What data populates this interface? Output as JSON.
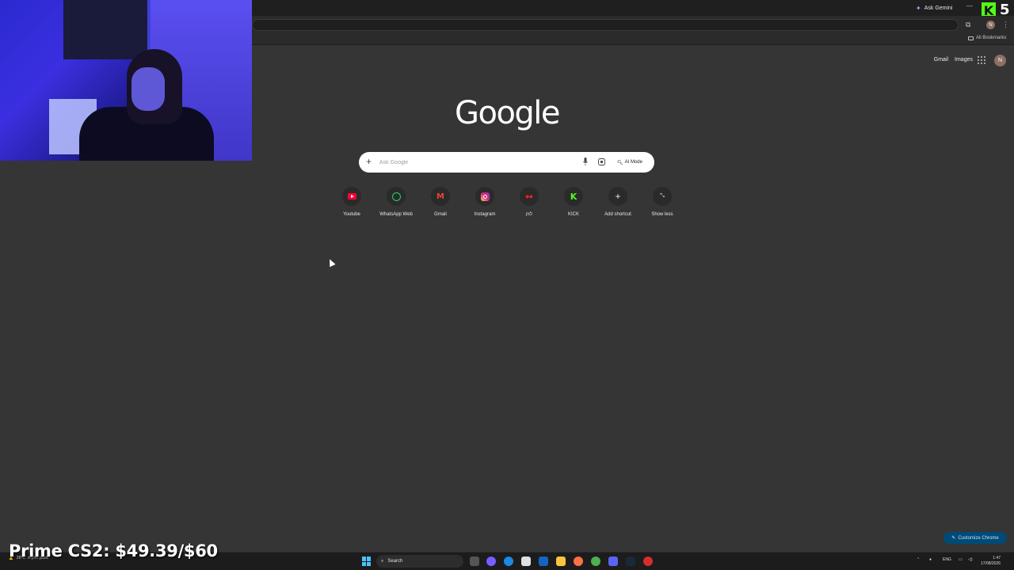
{
  "browser": {
    "ask_gemini": "Ask Gemini",
    "all_bookmarks": "All Bookmarks",
    "profile_initial": "N"
  },
  "stream_overlay": {
    "kick_letter": "K",
    "kick_count": "5",
    "prime_text": "Prime CS2: $49.39/$60"
  },
  "ntp": {
    "top_links": {
      "gmail": "Gmail",
      "images": "Images"
    },
    "profile_initial": "N",
    "logo": "Google",
    "search": {
      "placeholder": "Ask Google",
      "ai_mode": "AI Mode"
    },
    "shortcuts": [
      {
        "label": "Youtube",
        "icon": "youtube-icon"
      },
      {
        "label": "WhatsApp Web",
        "icon": "whatsapp-icon"
      },
      {
        "label": "Gmail",
        "icon": "gmail-icon"
      },
      {
        "label": "Instagram",
        "icon": "instagram-icon"
      },
      {
        "label": "לוזן",
        "icon": "site-icon"
      },
      {
        "label": "KICK",
        "icon": "kick-icon"
      },
      {
        "label": "Add shortcut",
        "icon": "plus-icon"
      },
      {
        "label": "Show less",
        "icon": "collapse-icon"
      }
    ],
    "customize": "Customize Chrome"
  },
  "taskbar": {
    "search": "Search",
    "lang": "ENG",
    "time": "1:47",
    "date": "17/08/2026",
    "weather_line1": "26°C",
    "weather_line2": "מעונן חלקית"
  },
  "colors": {
    "page_bg": "#353535",
    "kick_green": "#53fc18",
    "customize_bg": "#004a77"
  }
}
